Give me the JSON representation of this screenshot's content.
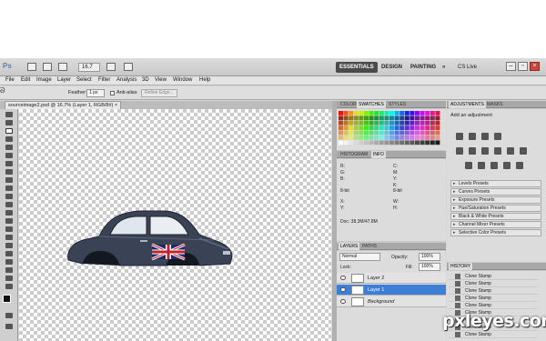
{
  "appbar": {
    "zoom": "16.7",
    "workspaces": [
      "ESSENTIALS",
      "DESIGN",
      "PAINTING"
    ],
    "more": "»",
    "cslive": "CS Live"
  },
  "menu": [
    "File",
    "Edit",
    "Image",
    "Layer",
    "Select",
    "Filter",
    "Analysis",
    "3D",
    "View",
    "Window",
    "Help"
  ],
  "options": {
    "feather_label": "Feather:",
    "feather_value": "1 px",
    "antialias_label": "Anti-alias",
    "refine_edge": "Refine Edge..."
  },
  "document": {
    "tab_label": "sourceimage2.psd @ 16.7% (Layer 1, RGB/8#) ×"
  },
  "panels": {
    "color_tabs": [
      "COLOR",
      "SWATCHES",
      "STYLES"
    ],
    "info_tabs": [
      "HISTOGRAM",
      "INFO"
    ],
    "info": {
      "r": "R:",
      "g": "G:",
      "b": "B:",
      "c": "C:",
      "m": "M:",
      "y": "Y:",
      "k": "K:",
      "bit1": "8-bit",
      "bit2": "8-bit",
      "x": "X:",
      "yc": "Y:",
      "w": "W:",
      "h": "H:",
      "doc": "Doc: 38.3M/47.8M"
    },
    "layers_tabs": [
      "LAYERS",
      "PATHS"
    ],
    "layers": {
      "blend": "Normal",
      "opacity_label": "Opacity:",
      "opacity": "100%",
      "lock_label": "Lock:",
      "fill_label": "Fill:",
      "fill": "100%",
      "items": [
        "Layer 2",
        "Layer 1",
        "Background"
      ]
    },
    "adjust_tabs": [
      "ADJUSTMENTS",
      "MASKS"
    ],
    "adjustments": {
      "title": "Add an adjustment",
      "presets": [
        "Levels Presets",
        "Curves Presets",
        "Exposure Presets",
        "Hue/Saturation Presets",
        "Black & White Presets",
        "Channel Mixer Presets",
        "Selective Color Presets"
      ]
    },
    "history_tabs": [
      "HISTORY"
    ],
    "history": [
      "Clone Stamp",
      "Clone Stamp",
      "Clone Stamp",
      "Clone Stamp",
      "Clone Stamp",
      "Clone Stamp",
      "Clone Stamp",
      "Clone Stamp",
      "Clone Stamp",
      "Clone Stamp"
    ]
  },
  "watermark": "pxleyes.com",
  "colors": {
    "selection": "#3d7fd6",
    "active_workspace": "#4a4a4a",
    "close": "#c9473c"
  }
}
